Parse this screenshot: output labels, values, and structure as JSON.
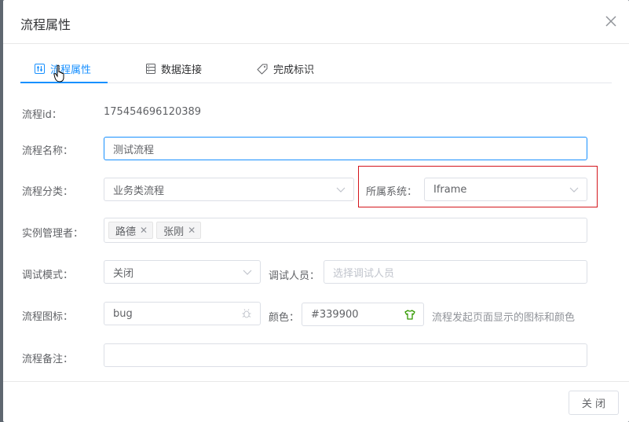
{
  "dialog": {
    "title": "流程属性",
    "close_icon": "close-icon"
  },
  "tabs": [
    {
      "label": "流程属性",
      "icon": "sliders-icon",
      "active": true
    },
    {
      "label": "数据连接",
      "icon": "database-icon",
      "active": false
    },
    {
      "label": "完成标识",
      "icon": "tag-icon",
      "active": false
    }
  ],
  "form": {
    "process_id": {
      "label": "流程id：",
      "value": "175454696120389"
    },
    "process_name": {
      "label": "流程名称：",
      "value": "测试流程"
    },
    "category": {
      "label": "流程分类：",
      "value": "业务类流程"
    },
    "system": {
      "label": "所属系统：",
      "value": "Iframe"
    },
    "managers": {
      "label": "实例管理者：",
      "tags": [
        "路德",
        "张刚"
      ]
    },
    "debug_mode": {
      "label": "调试模式：",
      "value": "关闭"
    },
    "debug_users": {
      "label": "调试人员：",
      "placeholder": "选择调试人员"
    },
    "icon": {
      "label": "流程图标：",
      "value": "bug"
    },
    "color": {
      "label": "颜色：",
      "value": "#339900"
    },
    "hint": "流程发起页面显示的图标和颜色",
    "remark": {
      "label": "流程备注：",
      "value": ""
    }
  },
  "footer": {
    "close_label": "关 闭"
  },
  "colors": {
    "accent": "#1890ff",
    "highlight_border": "#d4161d",
    "swatch": "#339900"
  }
}
